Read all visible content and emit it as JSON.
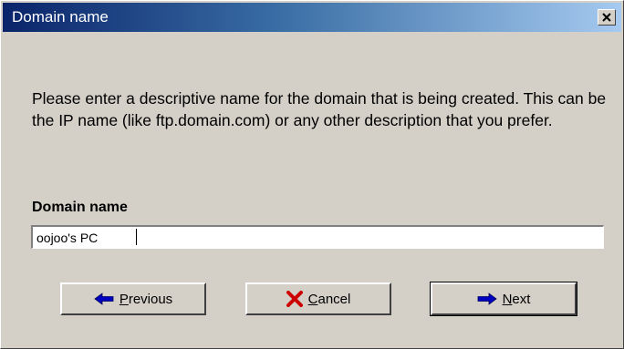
{
  "window": {
    "title": "Domain name"
  },
  "content": {
    "description": "Please enter a descriptive name for the domain that is being created. This can be the IP name (like ftp.domain.com) or any other description that you prefer.",
    "field_label": "Domain name",
    "field_value": "oojoo's PC"
  },
  "buttons": {
    "previous": "Previous",
    "cancel": "Cancel",
    "next": "Next"
  },
  "icons": {
    "close": "close-icon",
    "previous": "left-arrow-icon",
    "cancel": "red-x-icon",
    "next": "right-arrow-icon"
  },
  "colors": {
    "titlebar_start": "#0a246a",
    "titlebar_end": "#a6caf0",
    "face": "#d4d0c8",
    "arrow_blue": "#0000c0",
    "cancel_red": "#cc0000"
  }
}
